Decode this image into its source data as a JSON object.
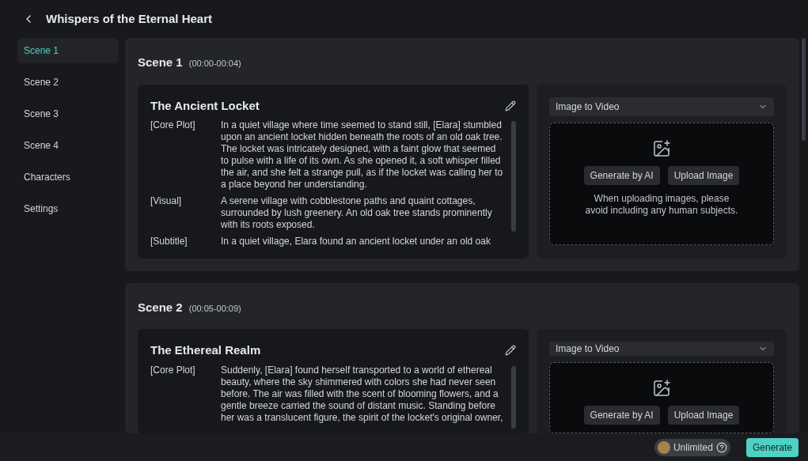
{
  "header": {
    "title": "Whispers of the Eternal Heart"
  },
  "sidebar": {
    "items": [
      {
        "label": "Scene 1",
        "selected": true
      },
      {
        "label": "Scene 2",
        "selected": false
      },
      {
        "label": "Scene 3",
        "selected": false
      },
      {
        "label": "Scene 4",
        "selected": false
      },
      {
        "label": "Characters",
        "selected": false
      },
      {
        "label": "Settings",
        "selected": false
      }
    ]
  },
  "scenes": [
    {
      "name": "Scene 1",
      "time": "(00:00-00:04)",
      "card": {
        "title": "The Ancient Locket",
        "fields": [
          {
            "label": "[Core Plot]",
            "text": "In a quiet village where time seemed to stand still, [Elara] stumbled upon an ancient locket hidden beneath the roots of an old oak tree. The locket was intricately designed, with a faint glow that seemed to pulse with a life of its own. As she opened it, a soft whisper filled the air, and she felt a strange pull, as if the locket was calling her to a place beyond her understanding."
          },
          {
            "label": "[Visual]",
            "text": "A serene village with cobblestone paths and quaint cottages, surrounded by lush greenery. An old oak tree stands prominently with its roots exposed."
          },
          {
            "label": "[Subtitle]",
            "text": "In a quiet village, Elara found an ancient locket under an old oak"
          }
        ]
      },
      "media": {
        "mode": "Image to Video",
        "buttons": [
          "Generate by AI",
          "Upload Image"
        ],
        "note": "When uploading images, please avoid including any human subjects."
      }
    },
    {
      "name": "Scene 2",
      "time": "(00:05-00:09)",
      "card": {
        "title": "The Ethereal Realm",
        "fields": [
          {
            "label": "[Core Plot]",
            "text": "Suddenly, [Elara] found herself transported to a world of ethereal beauty, where the sky shimmered with colors she had never seen before. The air was filled with the scent of blooming flowers, and a gentle breeze carried the sound of distant music. Standing before her was a translucent figure, the spirit of the locket's original owner,"
          }
        ]
      },
      "media": {
        "mode": "Image to Video",
        "buttons": [
          "Generate by AI",
          "Upload Image"
        ]
      }
    }
  ],
  "footer": {
    "credits": "Unlimited",
    "generate": "Generate"
  }
}
